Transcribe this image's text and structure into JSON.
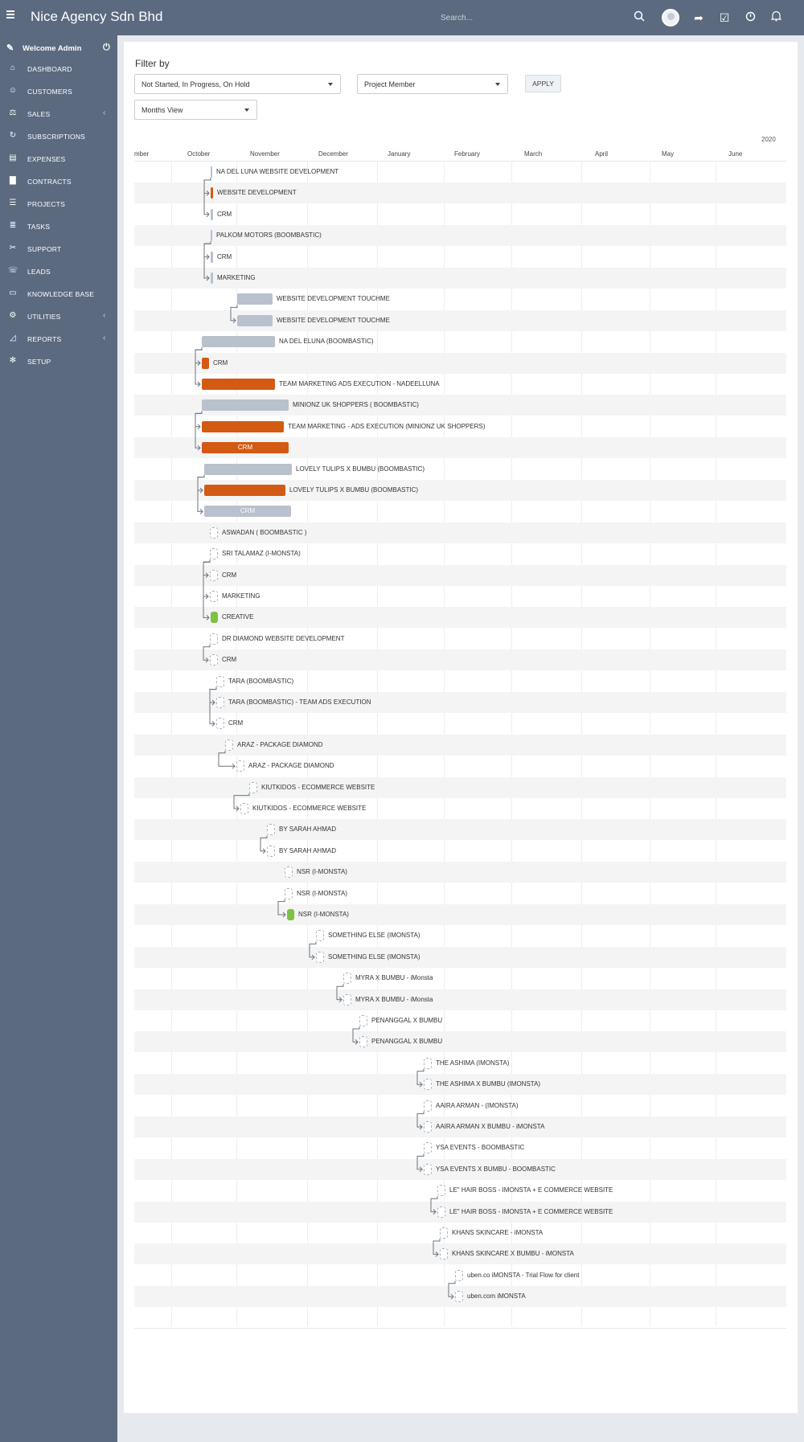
{
  "header": {
    "brand": "Nice Agency Sdn Bhd",
    "search_placeholder": "Search...",
    "icons": [
      "search-icon",
      "user-avatar",
      "share-icon",
      "todo-icon",
      "clock-icon",
      "bell-icon"
    ]
  },
  "sidebar": {
    "welcome": "Welcome Admin",
    "items": [
      {
        "label": "DASHBOARD",
        "icon": "home-icon",
        "has_submenu": false
      },
      {
        "label": "CUSTOMERS",
        "icon": "user-icon",
        "has_submenu": false
      },
      {
        "label": "SALES",
        "icon": "balance-icon",
        "has_submenu": true
      },
      {
        "label": "SUBSCRIPTIONS",
        "icon": "refresh-icon",
        "has_submenu": false
      },
      {
        "label": "EXPENSES",
        "icon": "file-icon",
        "has_submenu": false
      },
      {
        "label": "CONTRACTS",
        "icon": "document-icon",
        "has_submenu": false
      },
      {
        "label": "PROJECTS",
        "icon": "bars-icon",
        "has_submenu": false
      },
      {
        "label": "TASKS",
        "icon": "tasks-icon",
        "has_submenu": false
      },
      {
        "label": "SUPPORT",
        "icon": "ticket-icon",
        "has_submenu": false
      },
      {
        "label": "LEADS",
        "icon": "tty-icon",
        "has_submenu": false
      },
      {
        "label": "KNOWLEDGE BASE",
        "icon": "folder-open-icon",
        "has_submenu": false
      },
      {
        "label": "UTILITIES",
        "icon": "cogs-icon",
        "has_submenu": true
      },
      {
        "label": "REPORTS",
        "icon": "area-chart-icon",
        "has_submenu": true
      },
      {
        "label": "SETUP",
        "icon": "cog-icon",
        "has_submenu": false
      }
    ]
  },
  "filter": {
    "title": "Filter by",
    "status_value": "Not Started, In Progress, On Hold",
    "member_value": "Project Member",
    "view_value": "Months View",
    "apply_label": "APPLY"
  },
  "gantt": {
    "year": "2020",
    "months": [
      "mber",
      "October",
      "November",
      "December",
      "January",
      "February",
      "March",
      "April",
      "May",
      "June"
    ],
    "colors": {
      "grey": "#b8c1cc",
      "orange": "#d35a13",
      "green": "#7dc243"
    },
    "tasks": [
      {
        "label": "NA DEL LUNA WEBSITE DEVELOPMENT",
        "style": "empty-line"
      },
      {
        "label": "WEBSITE DEVELOPMENT",
        "style": "orange-mini"
      },
      {
        "label": "CRM",
        "style": "grey-mini"
      },
      {
        "label": "PALKOM MOTORS (BOOMBASTIC)",
        "style": "empty-line"
      },
      {
        "label": "CRM",
        "style": "grey-mini"
      },
      {
        "label": "MARKETING",
        "style": "grey-mini"
      },
      {
        "label": "WEBSITE DEVELOPMENT TOUCHME",
        "style": "grey"
      },
      {
        "label": "WEBSITE DEVELOPMENT TOUCHME",
        "style": "grey"
      },
      {
        "label": "NA DEL ELUNA (BOOMBASTIC)",
        "style": "grey"
      },
      {
        "label": "CRM",
        "style": "orange"
      },
      {
        "label": "TEAM MARKETING ADS EXECUTION - NADEELLUNA",
        "style": "orange"
      },
      {
        "label": "MINIONZ UK SHOPPERS ( BOOMBASTIC)",
        "style": "grey"
      },
      {
        "label": "TEAM MARKETING - ADS EXECUTION (MINIONZ UK SHOPPERS)",
        "style": "orange"
      },
      {
        "label": "CRM",
        "style": "orange",
        "inside": true
      },
      {
        "label": "LOVELY TULIPS X BUMBU (BOOMBASTIC)",
        "style": "grey"
      },
      {
        "label": "LOVELY TULIPS X BUMBU (BOOMBASTIC)",
        "style": "orange"
      },
      {
        "label": "CRM",
        "style": "grey",
        "inside": true
      },
      {
        "label": "ASWADAN ( BOOMBASTIC )",
        "style": "empty"
      },
      {
        "label": "SRI TALAMAZ (I-MONSTA)",
        "style": "empty"
      },
      {
        "label": "CRM",
        "style": "empty"
      },
      {
        "label": "MARKETING",
        "style": "empty"
      },
      {
        "label": "CREATIVE",
        "style": "green"
      },
      {
        "label": "DR DIAMOND WEBSITE DEVELOPMENT",
        "style": "empty"
      },
      {
        "label": "CRM",
        "style": "empty"
      },
      {
        "label": "TARA (BOOMBASTIC)",
        "style": "empty"
      },
      {
        "label": "TARA (BOOMBASTIC) - TEAM ADS EXECUTION",
        "style": "empty"
      },
      {
        "label": "CRM",
        "style": "empty"
      },
      {
        "label": "ARAZ - PACKAGE DIAMOND",
        "style": "empty"
      },
      {
        "label": "ARAZ - PACKAGE DIAMOND",
        "style": "empty"
      },
      {
        "label": "KIUTKIDOS - ECOMMERCE WEBSITE",
        "style": "empty"
      },
      {
        "label": "KIUTKIDOS - ECOMMERCE WEBSITE",
        "style": "empty"
      },
      {
        "label": "BY SARAH AHMAD",
        "style": "empty"
      },
      {
        "label": "BY SARAH AHMAD",
        "style": "empty"
      },
      {
        "label": "NSR (I-MONSTA)",
        "style": "empty"
      },
      {
        "label": "NSR (I-MONSTA)",
        "style": "empty"
      },
      {
        "label": "NSR (I-MONSTA)",
        "style": "green"
      },
      {
        "label": "SOMETHING ELSE (IMONSTA)",
        "style": "empty"
      },
      {
        "label": "SOMETHING ELSE (IMONSTA)",
        "style": "empty"
      },
      {
        "label": "MYRA X BUMBU - iMonsta",
        "style": "empty"
      },
      {
        "label": "MYRA X BUMBU - iMonsta",
        "style": "empty"
      },
      {
        "label": "PENANGGAL X BUMBU",
        "style": "empty"
      },
      {
        "label": "PENANGGAL X BUMBU",
        "style": "empty"
      },
      {
        "label": "THE ASHIMA (IMONSTA)",
        "style": "empty"
      },
      {
        "label": "THE ASHIMA X BUMBU (IMONSTA)",
        "style": "empty"
      },
      {
        "label": "AAIRA ARMAN - (IMONSTA)",
        "style": "empty"
      },
      {
        "label": "AAIRA ARMAN X BUMBU - iMONSTA",
        "style": "empty"
      },
      {
        "label": "YSA EVENTS - BOOMBASTIC",
        "style": "empty"
      },
      {
        "label": "YSA EVENTS X BUMBU - BOOMBASTIC",
        "style": "empty"
      },
      {
        "label": "LE\" HAIR BOSS - IMONSTA + E COMMERCE WEBSITE",
        "style": "empty"
      },
      {
        "label": "LE\" HAIR BOSS - IMONSTA + E COMMERCE WEBSITE",
        "style": "empty"
      },
      {
        "label": "KHANS SKINCARE - iMONSTA",
        "style": "empty"
      },
      {
        "label": "KHANS SKINCARE X BUMBU - iMONSTA",
        "style": "empty"
      },
      {
        "label": "uben.co iMONSTA - Trial Flow for client",
        "style": "empty"
      },
      {
        "label": "uben.com iMONSTA",
        "style": "empty"
      }
    ]
  }
}
